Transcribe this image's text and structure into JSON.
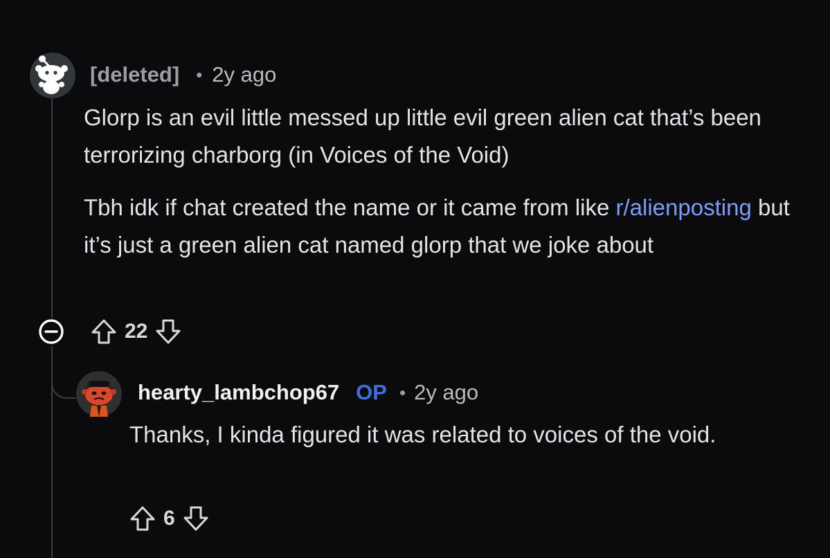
{
  "comment": {
    "author": "[deleted]",
    "separator": "•",
    "time": "2y ago",
    "paragraph1": "Glorp is an evil little messed up little evil green alien cat that’s been terrorizing charborg (in Voices of the Void)",
    "paragraph2_link": "r/alienposting",
    "paragraph2_rest": " but it’s just a green alien cat named glorp that we joke about",
    "paragraph2_prefix": "Tbh idk if chat created the name or it came from like ",
    "votes": "22"
  },
  "reply": {
    "author": "hearty_lambchop67",
    "badge": "OP",
    "separator": "•",
    "time": "2y ago",
    "text": "Thanks, I kinda figured it was related to voices of the void.",
    "votes": "6"
  },
  "colors": {
    "background": "#0b0b0d",
    "link": "#7c9ef7",
    "op_badge": "#3c6fe0",
    "thread_line": "#3a3d40"
  },
  "icons": {
    "avatar_deleted": "snoo-avatar-icon",
    "avatar_reply": "red-snoo-avatar-icon",
    "collapse": "collapse-minus-icon",
    "upvote": "upvote-arrow-icon",
    "downvote": "downvote-arrow-icon"
  }
}
